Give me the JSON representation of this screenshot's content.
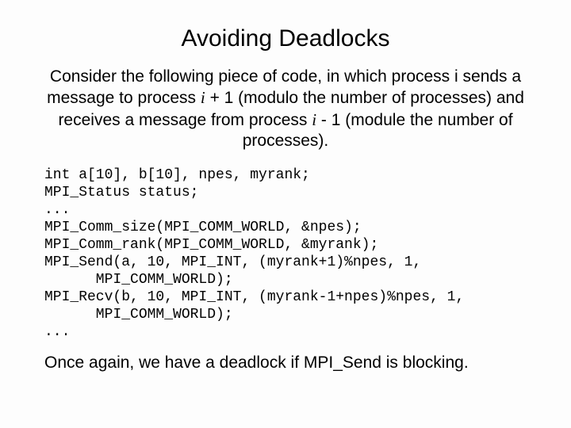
{
  "title": "Avoiding Deadlocks",
  "intro": {
    "part1": "Consider the following piece of code, in which process i sends a message to process ",
    "i1": "i",
    "part2": " + 1 (modulo the number of processes) and receives a message from process ",
    "i2": "i",
    "part3": " - 1 (module the number of processes)."
  },
  "code": "int a[10], b[10], npes, myrank;\nMPI_Status status;\n...\nMPI_Comm_size(MPI_COMM_WORLD, &npes);\nMPI_Comm_rank(MPI_COMM_WORLD, &myrank);\nMPI_Send(a, 10, MPI_INT, (myrank+1)%npes, 1,\n      MPI_COMM_WORLD);\nMPI_Recv(b, 10, MPI_INT, (myrank-1+npes)%npes, 1,\n      MPI_COMM_WORLD);\n...",
  "closing": {
    "text": "Once again, we have a deadlock if MPI_Send is blocking",
    "dot": "."
  }
}
